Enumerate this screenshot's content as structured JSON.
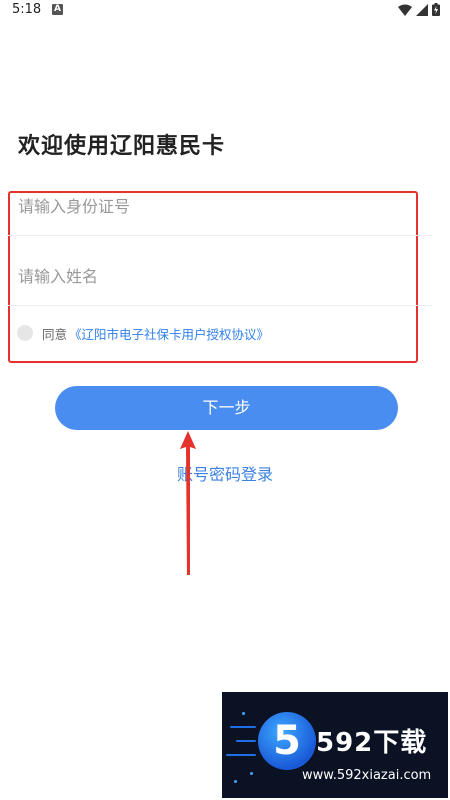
{
  "status_bar": {
    "time": "5:18",
    "notification_icon_letter": "A",
    "wifi_icon": "wifi-icon",
    "signal_icon": "signal-icon",
    "battery_icon": "battery-icon"
  },
  "page": {
    "title": "欢迎使用辽阳惠民卡"
  },
  "form": {
    "id_number_placeholder": "请输入身份证号",
    "name_placeholder": "请输入姓名",
    "agree_label": "同意",
    "agreement_link": "《辽阳市电子社保卡用户授权协议》"
  },
  "actions": {
    "next_label": "下一步",
    "account_login_label": "账号密码登录"
  },
  "watermark": {
    "digit": "5",
    "brand": "592下载",
    "url": "www.592xiazai.com"
  },
  "colors": {
    "accent": "#4a8df0",
    "link": "#2f80ed",
    "highlight": "#e5322d"
  }
}
